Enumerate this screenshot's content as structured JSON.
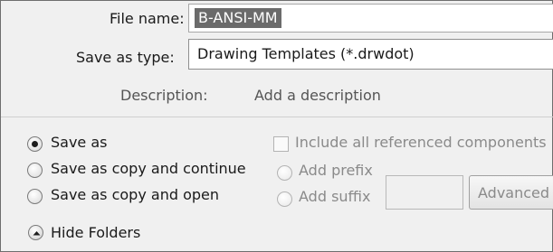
{
  "file_name": {
    "label": "File name:",
    "value": "B-ANSI-MM"
  },
  "save_as_type": {
    "label": "Save as type:",
    "value": "Drawing Templates (*.drwdot)"
  },
  "description": {
    "label": "Description:",
    "placeholder": "Add a description"
  },
  "save_options": [
    {
      "label": "Save as",
      "selected": true
    },
    {
      "label": "Save as copy and continue",
      "selected": false
    },
    {
      "label": "Save as copy and open",
      "selected": false
    }
  ],
  "references": {
    "include_all_label": "Include all referenced components",
    "add_prefix_label": "Add prefix",
    "add_suffix_label": "Add suffix",
    "advanced_label": "Advanced"
  },
  "folders": {
    "toggle_label": "Hide Folders",
    "icon": "chevron-up-icon"
  }
}
